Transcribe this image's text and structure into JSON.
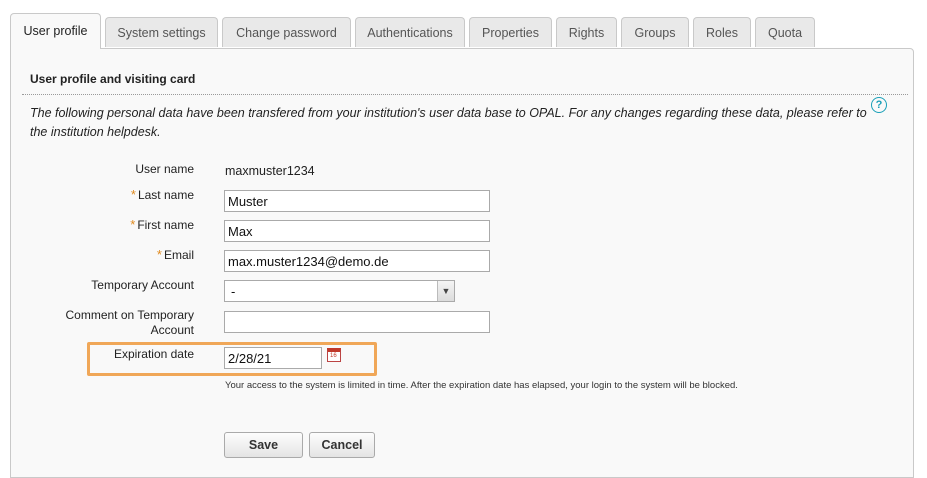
{
  "tabs": [
    {
      "label": "User profile",
      "active": true
    },
    {
      "label": "System settings"
    },
    {
      "label": "Change password"
    },
    {
      "label": "Authentications"
    },
    {
      "label": "Properties"
    },
    {
      "label": "Rights"
    },
    {
      "label": "Groups"
    },
    {
      "label": "Roles"
    },
    {
      "label": "Quota"
    }
  ],
  "section": {
    "heading": "User profile and visiting card",
    "intro": "The following personal data have been transfered from your institution's user data base to OPAL. For any changes regarding these data, please refer to the institution helpdesk.",
    "help_icon": "?"
  },
  "form": {
    "required_marker": "*",
    "username": {
      "label": "User name",
      "value": "maxmuster1234"
    },
    "lastname": {
      "label": "Last name",
      "value": "Muster",
      "required": true
    },
    "firstname": {
      "label": "First name",
      "value": "Max",
      "required": true
    },
    "email": {
      "label": "Email",
      "value": "max.muster1234@demo.de",
      "required": true
    },
    "temporary_account": {
      "label": "Temporary Account",
      "value": "-",
      "arrow": "▼"
    },
    "comment_temporary": {
      "label_line1": "Comment on Temporary",
      "label_line2": "Account",
      "value": ""
    },
    "expiration": {
      "label": "Expiration date",
      "value": "2/28/21",
      "calendar_text": "16",
      "hint": "Your access to the system is limited in time. After the expiration date has elapsed, your login to the system will be blocked."
    }
  },
  "buttons": {
    "save": "Save",
    "cancel": "Cancel"
  },
  "colors": {
    "required": "#e08a1e",
    "highlight": "#f0a758",
    "help": "#1aa0b8"
  }
}
